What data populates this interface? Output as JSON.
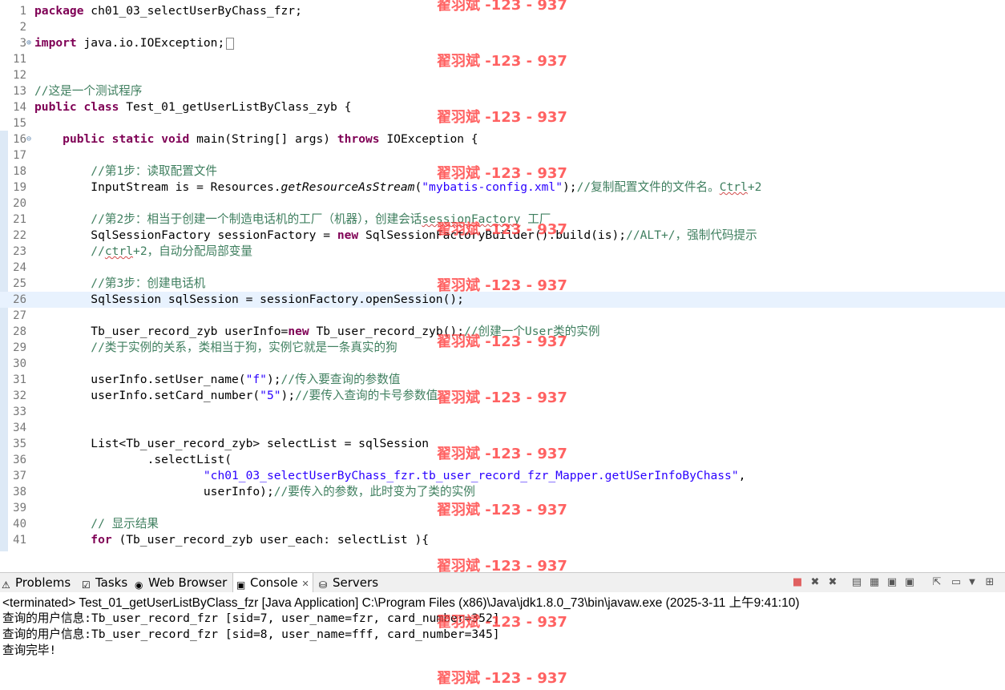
{
  "editor": {
    "lines": [
      {
        "n": "1",
        "parts": [
          {
            "t": "package ",
            "c": "kw"
          },
          {
            "t": "ch01_03_selectUserByChass_fzr;",
            "c": ""
          }
        ]
      },
      {
        "n": "2",
        "parts": []
      },
      {
        "n": "3",
        "fold": "⊕",
        "parts": [
          {
            "t": "import ",
            "c": "kw"
          },
          {
            "t": "java.io.IOException;",
            "c": ""
          },
          {
            "t": "",
            "c": "box"
          }
        ]
      },
      {
        "n": "11",
        "parts": []
      },
      {
        "n": "12",
        "parts": []
      },
      {
        "n": "13",
        "parts": [
          {
            "t": "//这是一个测试程序",
            "c": "cm"
          }
        ]
      },
      {
        "n": "14",
        "parts": [
          {
            "t": "public ",
            "c": "kw"
          },
          {
            "t": "class ",
            "c": "kw"
          },
          {
            "t": "Test_01_getUserListByClass_zyb {",
            "c": ""
          }
        ]
      },
      {
        "n": "15",
        "parts": []
      },
      {
        "n": "16",
        "fold": "⊖",
        "parts": [
          {
            "t": "    ",
            "c": ""
          },
          {
            "t": "public ",
            "c": "kw"
          },
          {
            "t": "static ",
            "c": "kw"
          },
          {
            "t": "void ",
            "c": "kw"
          },
          {
            "t": "main(String[] args) ",
            "c": ""
          },
          {
            "t": "throws ",
            "c": "kw"
          },
          {
            "t": "IOException {",
            "c": ""
          }
        ]
      },
      {
        "n": "17",
        "parts": []
      },
      {
        "n": "18",
        "parts": [
          {
            "t": "        ",
            "c": ""
          },
          {
            "t": "//第1步：读取配置文件",
            "c": "cm"
          }
        ]
      },
      {
        "n": "19",
        "parts": [
          {
            "t": "        InputStream is = Resources.",
            "c": ""
          },
          {
            "t": "getResourceAsStream",
            "c": "it"
          },
          {
            "t": "(",
            "c": ""
          },
          {
            "t": "\"mybatis-config.xml\"",
            "c": "st"
          },
          {
            "t": ");",
            "c": ""
          },
          {
            "t": "//复制配置文件的文件名。",
            "c": "cm"
          },
          {
            "t": "Ctrl",
            "c": "cm squig"
          },
          {
            "t": "+2",
            "c": "cm"
          }
        ]
      },
      {
        "n": "20",
        "parts": []
      },
      {
        "n": "21",
        "parts": [
          {
            "t": "        ",
            "c": ""
          },
          {
            "t": "//第2步：相当于创建一个制造电话机的工厂（机器），创建会话",
            "c": "cm"
          },
          {
            "t": "sessionFactory",
            "c": "cm squig"
          },
          {
            "t": " 工厂",
            "c": "cm"
          }
        ]
      },
      {
        "n": "22",
        "parts": [
          {
            "t": "        SqlSessionFactory sessionFactory = ",
            "c": ""
          },
          {
            "t": "new ",
            "c": "kw"
          },
          {
            "t": "SqlSessionFactoryBuilder().build(is);",
            "c": ""
          },
          {
            "t": "//ALT+/，强制代码提示",
            "c": "cm"
          }
        ]
      },
      {
        "n": "23",
        "parts": [
          {
            "t": "        ",
            "c": ""
          },
          {
            "t": "//",
            "c": "cm"
          },
          {
            "t": "ctrl",
            "c": "cm squig"
          },
          {
            "t": "+2，自动分配局部变量",
            "c": "cm"
          }
        ]
      },
      {
        "n": "24",
        "parts": []
      },
      {
        "n": "25",
        "parts": [
          {
            "t": "        ",
            "c": ""
          },
          {
            "t": "//第3步：创建电话机",
            "c": "cm"
          }
        ]
      },
      {
        "n": "26",
        "current": true,
        "parts": [
          {
            "t": "        SqlSession sqlSession = sessionFactory.openSession();",
            "c": ""
          }
        ]
      },
      {
        "n": "27",
        "parts": []
      },
      {
        "n": "28",
        "parts": [
          {
            "t": "        Tb_user_record_zyb userInfo=",
            "c": ""
          },
          {
            "t": "new ",
            "c": "kw"
          },
          {
            "t": "Tb_user_record_zyb();",
            "c": ""
          },
          {
            "t": "//创建一个User类的实例",
            "c": "cm"
          }
        ]
      },
      {
        "n": "29",
        "parts": [
          {
            "t": "        ",
            "c": ""
          },
          {
            "t": "//类于实例的关系，类相当于狗，实例它就是一条真实的狗",
            "c": "cm"
          }
        ]
      },
      {
        "n": "30",
        "parts": []
      },
      {
        "n": "31",
        "parts": [
          {
            "t": "        userInfo.setUser_name(",
            "c": ""
          },
          {
            "t": "\"f\"",
            "c": "st"
          },
          {
            "t": ");",
            "c": ""
          },
          {
            "t": "//传入要查询的参数值",
            "c": "cm"
          }
        ]
      },
      {
        "n": "32",
        "parts": [
          {
            "t": "        userInfo.setCard_number(",
            "c": ""
          },
          {
            "t": "\"5\"",
            "c": "st"
          },
          {
            "t": ");",
            "c": ""
          },
          {
            "t": "//要传入查询的卡号参数值",
            "c": "cm"
          }
        ]
      },
      {
        "n": "33",
        "parts": []
      },
      {
        "n": "34",
        "parts": []
      },
      {
        "n": "35",
        "parts": [
          {
            "t": "        List<Tb_user_record_zyb> selectList = sqlSession",
            "c": ""
          }
        ]
      },
      {
        "n": "36",
        "parts": [
          {
            "t": "                .selectList(",
            "c": ""
          }
        ]
      },
      {
        "n": "37",
        "parts": [
          {
            "t": "                        ",
            "c": ""
          },
          {
            "t": "\"ch01_03_selectUserByChass_fzr.tb_user_record_fzr_Mapper.getUSerInfoByChass\"",
            "c": "st"
          },
          {
            "t": ",",
            "c": ""
          }
        ]
      },
      {
        "n": "38",
        "parts": [
          {
            "t": "                        userInfo);",
            "c": ""
          },
          {
            "t": "//要传入的参数，此时变为了类的实例",
            "c": "cm"
          }
        ]
      },
      {
        "n": "39",
        "parts": []
      },
      {
        "n": "40",
        "parts": [
          {
            "t": "        ",
            "c": ""
          },
          {
            "t": "// 显示结果",
            "c": "cm"
          }
        ]
      },
      {
        "n": "41",
        "parts": [
          {
            "t": "        ",
            "c": ""
          },
          {
            "t": "for ",
            "c": "kw"
          },
          {
            "t": "(Tb_user_record_zyb user_each: selectList ){",
            "c": ""
          }
        ]
      }
    ]
  },
  "tabs": [
    {
      "name": "tab-problems",
      "label": "Problems",
      "icon": "problems-icon"
    },
    {
      "name": "tab-tasks",
      "label": "Tasks",
      "icon": "tasks-icon"
    },
    {
      "name": "tab-web-browser",
      "label": "Web Browser",
      "icon": "globe-icon"
    },
    {
      "name": "tab-console",
      "label": "Console",
      "icon": "console-icon",
      "active": true,
      "close": "✕"
    },
    {
      "name": "tab-servers",
      "label": "Servers",
      "icon": "servers-icon"
    }
  ],
  "console": {
    "status": "<terminated> Test_01_getUserListByClass_fzr [Java Application] C:\\Program Files (x86)\\Java\\jdk1.8.0_73\\bin\\javaw.exe (2025-3-11 上午9:41:10)",
    "output": [
      "查询的用户信息:Tb_user_record_fzr [sid=7, user_name=fzr, card_number=352]",
      "查询的用户信息:Tb_user_record_fzr [sid=8, user_name=fff, card_number=345]",
      "查询完毕!"
    ]
  },
  "watermark": "翟羽斌 -123 - 937",
  "colors": {
    "keyword": "#7f0055",
    "comment": "#3f7f5f",
    "string": "#2a00ff",
    "watermark": "#ff3b3b"
  }
}
